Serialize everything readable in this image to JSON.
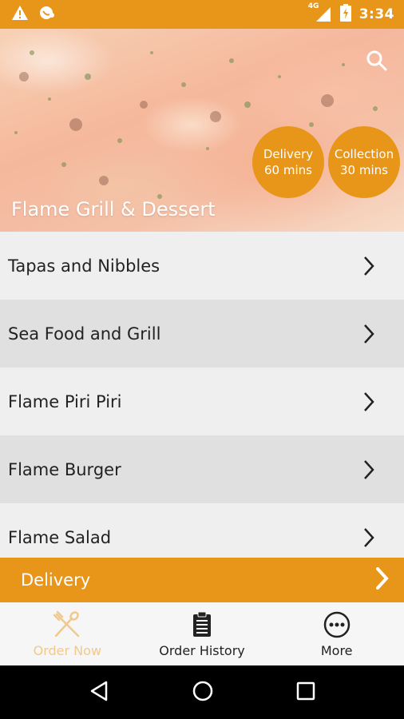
{
  "status_bar": {
    "time": "3:34",
    "network": "4G",
    "icons": [
      "warning-icon",
      "phone-icon",
      "signal-icon",
      "battery-charging-icon"
    ]
  },
  "hero": {
    "restaurant_name": "Flame Grill & Dessert",
    "search_icon": "search-icon",
    "delivery_pill": {
      "line1": "Delivery",
      "line2": "60 mins"
    },
    "collection_pill": {
      "line1": "Collection",
      "line2": "30 mins"
    }
  },
  "menu": {
    "items": [
      {
        "label": "Tapas and Nibbles"
      },
      {
        "label": "Sea Food and Grill"
      },
      {
        "label": "Flame Piri Piri"
      },
      {
        "label": "Flame Burger"
      },
      {
        "label": "Flame Salad"
      }
    ]
  },
  "delivery_bar": {
    "label": "Delivery"
  },
  "tabs": [
    {
      "label": "Order Now",
      "icon": "fork-spoon-icon",
      "active": true
    },
    {
      "label": "Order History",
      "icon": "clipboard-icon",
      "active": false
    },
    {
      "label": "More",
      "icon": "more-dots-icon",
      "active": false
    }
  ],
  "colors": {
    "accent": "#E8961A",
    "tab_active": "#F2C98B"
  }
}
